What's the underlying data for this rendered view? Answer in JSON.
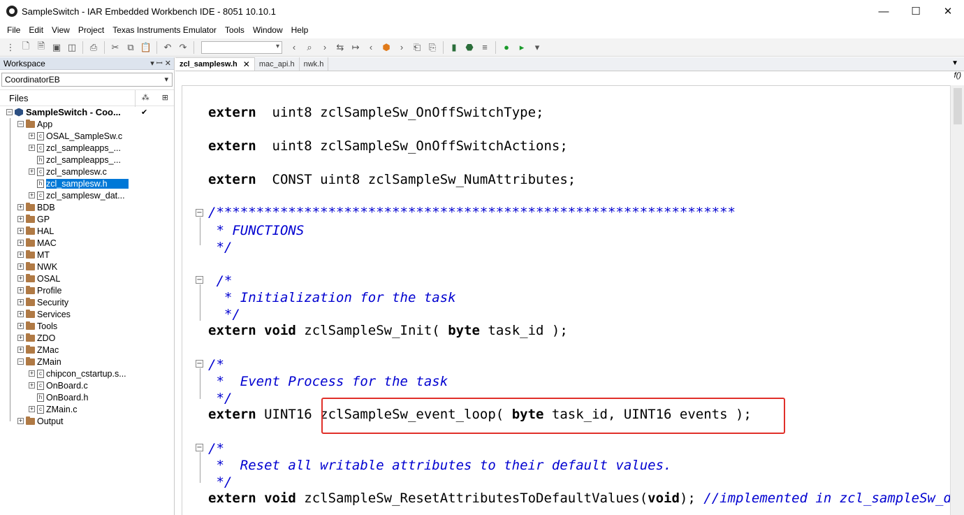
{
  "window": {
    "title": "SampleSwitch - IAR Embedded Workbench IDE - 8051 10.10.1",
    "minimize": "—",
    "maximize": "☐",
    "close": "✕"
  },
  "menu": [
    "File",
    "Edit",
    "View",
    "Project",
    "Texas Instruments Emulator",
    "Tools",
    "Window",
    "Help"
  ],
  "workspace": {
    "header": "Workspace",
    "pin": "▾ ꟷ ✕",
    "config": "CoordinatorEB",
    "files_label": "Files",
    "project": "SampleSwitch - Coo...",
    "tree": [
      {
        "label": "App",
        "type": "folder",
        "level": 1,
        "expander": "⊟"
      },
      {
        "label": "OSAL_SampleSw.c",
        "type": "c",
        "level": 2,
        "expander": "⊞"
      },
      {
        "label": "zcl_sampleapps_...",
        "type": "c",
        "level": 2,
        "expander": "⊞"
      },
      {
        "label": "zcl_sampleapps_...",
        "type": "h",
        "level": 2,
        "expander": ""
      },
      {
        "label": "zcl_samplesw.c",
        "type": "c",
        "level": 2,
        "expander": "⊞"
      },
      {
        "label": "zcl_samplesw.h",
        "type": "h",
        "level": 2,
        "expander": "",
        "selected": true
      },
      {
        "label": "zcl_samplesw_dat...",
        "type": "c",
        "level": 2,
        "expander": "⊞"
      },
      {
        "label": "BDB",
        "type": "folder",
        "level": 1,
        "expander": "⊞"
      },
      {
        "label": "GP",
        "type": "folder",
        "level": 1,
        "expander": "⊞"
      },
      {
        "label": "HAL",
        "type": "folder",
        "level": 1,
        "expander": "⊞"
      },
      {
        "label": "MAC",
        "type": "folder",
        "level": 1,
        "expander": "⊞"
      },
      {
        "label": "MT",
        "type": "folder",
        "level": 1,
        "expander": "⊞"
      },
      {
        "label": "NWK",
        "type": "folder",
        "level": 1,
        "expander": "⊞"
      },
      {
        "label": "OSAL",
        "type": "folder",
        "level": 1,
        "expander": "⊞"
      },
      {
        "label": "Profile",
        "type": "folder",
        "level": 1,
        "expander": "⊞"
      },
      {
        "label": "Security",
        "type": "folder",
        "level": 1,
        "expander": "⊞"
      },
      {
        "label": "Services",
        "type": "folder",
        "level": 1,
        "expander": "⊞"
      },
      {
        "label": "Tools",
        "type": "folder",
        "level": 1,
        "expander": "⊞"
      },
      {
        "label": "ZDO",
        "type": "folder",
        "level": 1,
        "expander": "⊞"
      },
      {
        "label": "ZMac",
        "type": "folder",
        "level": 1,
        "expander": "⊞"
      },
      {
        "label": "ZMain",
        "type": "folder",
        "level": 1,
        "expander": "⊟"
      },
      {
        "label": "chipcon_cstartup.s...",
        "type": "c",
        "level": 2,
        "expander": "⊞"
      },
      {
        "label": "OnBoard.c",
        "type": "c",
        "level": 2,
        "expander": "⊞"
      },
      {
        "label": "OnBoard.h",
        "type": "h",
        "level": 2,
        "expander": ""
      },
      {
        "label": "ZMain.c",
        "type": "c",
        "level": 2,
        "expander": "⊞"
      },
      {
        "label": "Output",
        "type": "folder",
        "level": 1,
        "expander": "⊞"
      }
    ]
  },
  "tabs": [
    {
      "label": "zcl_samplesw.h",
      "active": true,
      "close": "✕"
    },
    {
      "label": "mac_api.h",
      "active": false
    },
    {
      "label": "nwk.h",
      "active": false
    }
  ],
  "tabs_dropdown": "▼",
  "fn_icon": "f()",
  "code": [
    {
      "parts": [
        [
          "kw",
          "extern"
        ],
        [
          "",
          "  uint8 zclSampleSw_OnOffSwitchType;"
        ]
      ]
    },
    {
      "parts": [
        [
          "kw",
          "extern"
        ],
        [
          "",
          "  uint8 zclSampleSw_OnOffSwitchActions;"
        ]
      ]
    },
    {
      "parts": [
        [
          "kw",
          "extern"
        ],
        [
          "",
          "  CONST uint8 zclSampleSw_NumAttributes;"
        ]
      ]
    },
    {
      "parts": [
        [
          "cm",
          "/*****************************************************************"
        ]
      ]
    },
    {
      "parts": [
        [
          "cm",
          " * FUNCTIONS"
        ]
      ]
    },
    {
      "parts": [
        [
          "cm",
          " */"
        ]
      ]
    },
    {
      "parts": [
        [
          "cm",
          " /*"
        ]
      ]
    },
    {
      "parts": [
        [
          "cm",
          "  * Initialization for the task"
        ]
      ]
    },
    {
      "parts": [
        [
          "cm",
          "  */"
        ]
      ]
    },
    {
      "parts": [
        [
          "kw",
          "extern void"
        ],
        [
          "",
          " zclSampleSw_Init( "
        ],
        [
          "kw",
          "byte"
        ],
        [
          "",
          " task_id );"
        ]
      ]
    },
    {
      "parts": [
        [
          "cm",
          "/*"
        ]
      ]
    },
    {
      "parts": [
        [
          "cm",
          " *  Event Process for the task"
        ]
      ]
    },
    {
      "parts": [
        [
          "cm",
          " */"
        ]
      ]
    },
    {
      "parts": [
        [
          "kw",
          "extern"
        ],
        [
          "",
          " UINT16 zclSampleSw_event_loop( "
        ],
        [
          "kw",
          "byte"
        ],
        [
          "",
          " task_id, UINT16 events );"
        ]
      ]
    },
    {
      "parts": [
        [
          "cm",
          "/*"
        ]
      ]
    },
    {
      "parts": [
        [
          "cm",
          " *  Reset all writable attributes to their default values."
        ]
      ]
    },
    {
      "parts": [
        [
          "cm",
          " */"
        ]
      ]
    },
    {
      "parts": [
        [
          "kw",
          "extern void"
        ],
        [
          "",
          " zclSampleSw_ResetAttributesToDefaultValues("
        ],
        [
          "kw",
          "void"
        ],
        [
          "",
          "); "
        ],
        [
          "cm",
          "//implemented in zcl_sampleSw_data.c"
        ]
      ]
    }
  ]
}
